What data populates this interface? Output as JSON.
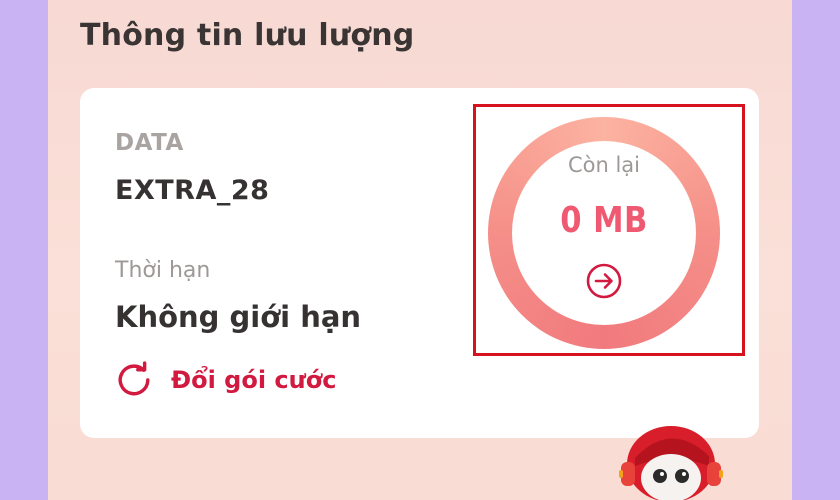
{
  "section": {
    "title": "Thông tin lưu lượng"
  },
  "package": {
    "type_label": "DATA",
    "name": "EXTRA_28",
    "term_label": "Thời hạn",
    "term_value": "Không giới hạn",
    "change_label": "Đổi gói cước"
  },
  "remaining": {
    "label": "Còn lại",
    "value": "0 MB"
  },
  "icons": {
    "change": "refresh-icon",
    "detail": "arrow-right-circle-icon",
    "mascot": "mascot-robot-image"
  },
  "colors": {
    "accent": "#d2193f",
    "ring_value": "#ef5971",
    "highlight_box": "#d7121f"
  }
}
